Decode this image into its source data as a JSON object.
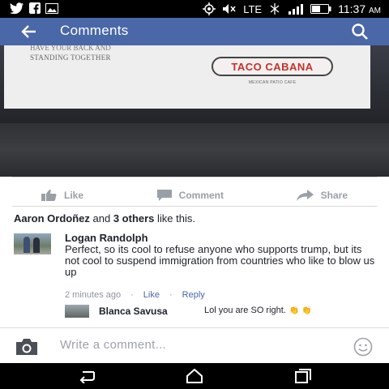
{
  "status_bar": {
    "network": "LTE",
    "time": "11:37",
    "ampm": "AM"
  },
  "app_bar": {
    "title": "Comments"
  },
  "photo": {
    "paper_line1": "HAVE YOUR BACK AND",
    "paper_line2": "STANDING TOGETHER",
    "logo_text": "TACO CABANA",
    "logo_subtext": "MEXICAN PATIO CAFE"
  },
  "actions": {
    "like_label": "Like",
    "comment_label": "Comment",
    "share_label": "Share"
  },
  "likes": {
    "name": "Aaron Ordoñez",
    "mid": " and ",
    "others": "3 others",
    "suffix": " like this."
  },
  "comment": {
    "author": "Logan Randolph",
    "text": "Perfect, so its cool to refuse anyone who supports trump, but its not cool to suspend immigration from countries who like to blow us up",
    "time": "2 minutes ago",
    "like_label": "Like",
    "reply_label": "Reply"
  },
  "reply": {
    "author": "Blanca Savusa",
    "text": "Lol you are SO right."
  },
  "composer": {
    "placeholder": "Write a comment..."
  },
  "colors": {
    "brand_blue": "#4a67a8",
    "muted_gray": "#9a9fa7"
  }
}
